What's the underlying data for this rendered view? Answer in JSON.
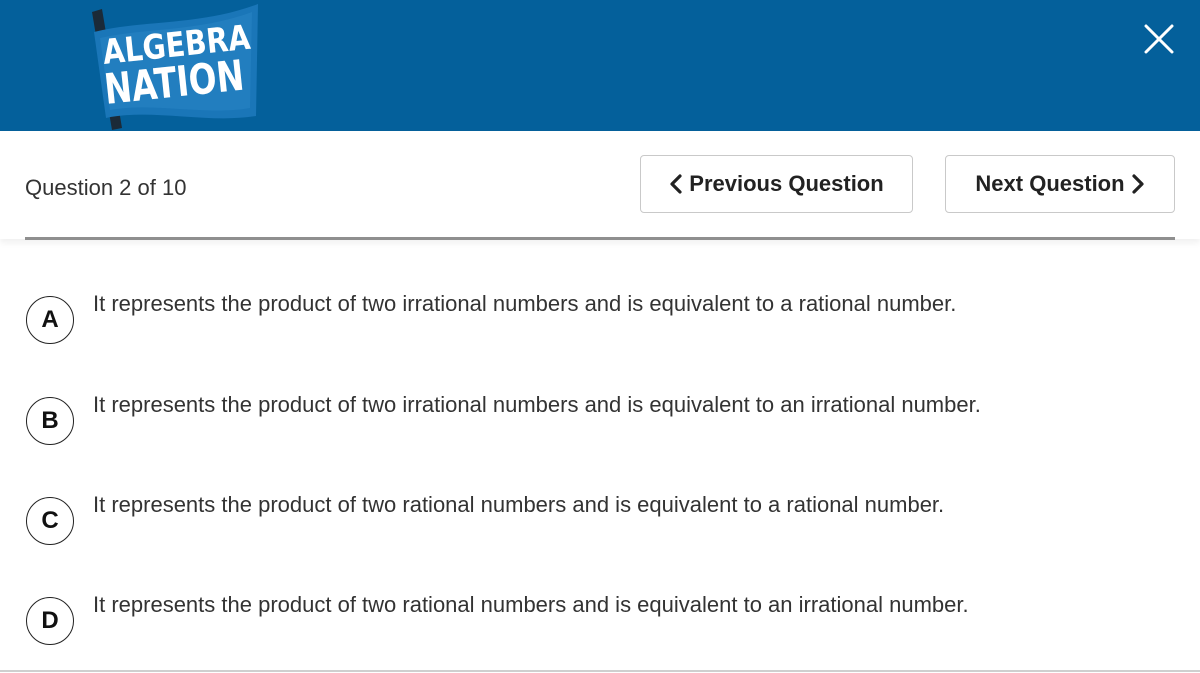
{
  "header": {
    "logo_line1": "ALGEBRA",
    "logo_line2": "NATION",
    "background_color": "#04609b",
    "close_icon": "close-icon"
  },
  "question_nav": {
    "counter": "Question 2 of 10",
    "previous_label": "Previous Question",
    "next_label": "Next Question",
    "previous_icon": "chevron-left-icon",
    "next_icon": "chevron-right-icon"
  },
  "choices": [
    {
      "letter": "A",
      "text": "It represents the product of two irrational numbers and is equivalent to a rational number."
    },
    {
      "letter": "B",
      "text": "It represents the product of two irrational numbers and is equivalent to an irrational number."
    },
    {
      "letter": "C",
      "text": "It represents the product of two rational numbers and is equivalent to a rational number."
    },
    {
      "letter": "D",
      "text": "It represents the product of two rational numbers and is equivalent to an irrational number."
    }
  ]
}
